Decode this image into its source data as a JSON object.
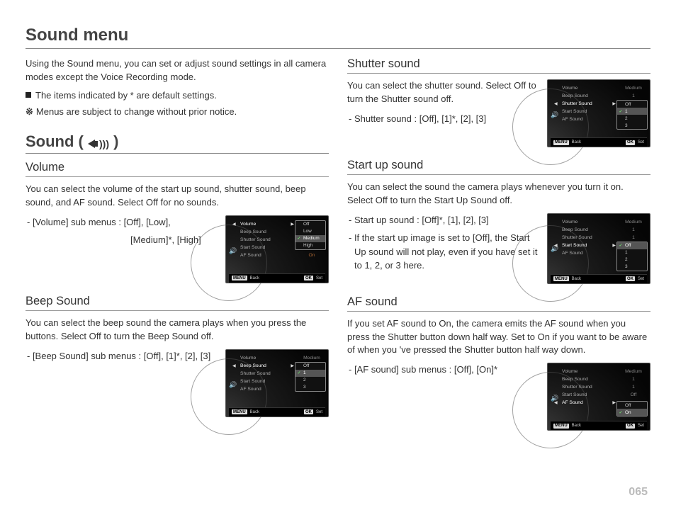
{
  "page": {
    "title": "Sound menu",
    "intro": "Using the Sound menu, you can set or adjust sound settings in all camera modes except the Voice Recording mode.",
    "note1": "The items indicated by * are default settings.",
    "note2": "Menus are subject to change without prior notice.",
    "section_h": "Sound (",
    "section_h_close": " )",
    "pnum": "065"
  },
  "volume": {
    "h": "Volume",
    "body": "You can select the volume of the start up sound,  shutter sound, beep sound, and AF sound. Select Off for no sounds.",
    "opt1": "- [Volume] sub menus : [Off], [Low],",
    "opt2": "[Medium]*, [High]"
  },
  "beep": {
    "h": "Beep Sound",
    "body": "You can select the beep sound the camera plays when you press the buttons. Select Off to turn the Beep Sound off.",
    "opt": "- [Beep Sound] sub menus : [Off], [1]*, [2], [3]"
  },
  "shutter": {
    "h": "Shutter sound",
    "body": "You can select the shutter sound. Select Off to turn the Shutter sound off.",
    "opt": "- Shutter sound : [Off], [1]*, [2], [3]"
  },
  "startup": {
    "h": "Start up sound",
    "body": "You can select the sound the camera plays whenever you turn it on. Select Off to turn the Start Up Sound off.",
    "opt": "- Start up sound : [Off]*, [1], [2], [3]",
    "note": "- If the start up image is set to [Off], the Start Up sound will not play, even if you have set it to 1, 2, or 3 here."
  },
  "af": {
    "h": "AF sound",
    "body": "If you set AF sound to On, the camera emits the AF sound when you press the Shutter button down half way. Set to On if you want to be aware of when you 've pressed the Shutter button half way down.",
    "opt": "- [AF sound] sub menus : [Off], [On]*"
  },
  "cam": {
    "items": {
      "volume": "Volume",
      "beep": "Beep Sound",
      "shutter": "Shutter Sound",
      "start": "Start Sound",
      "af": "AF Sound"
    },
    "vals": {
      "medium": "Medium",
      "one": "1",
      "off": "Off",
      "on": "On"
    },
    "popup_vol": {
      "off": "Off",
      "low": "Low",
      "med": "Medium",
      "high": "High"
    },
    "popup_nums": {
      "off": "Off",
      "n1": "1",
      "n2": "2",
      "n3": "3"
    },
    "popup_onoff": {
      "off": "Off",
      "on": "On"
    },
    "footer": {
      "menu": "MENU",
      "back": "Back",
      "ok": "OK",
      "set": "Set"
    }
  }
}
